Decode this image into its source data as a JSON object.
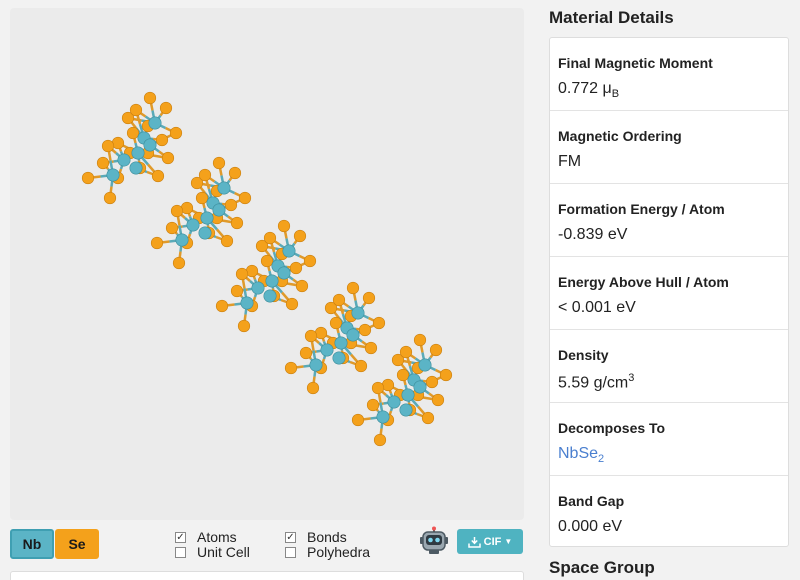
{
  "viewer": {
    "element_buttons": [
      {
        "label": "Nb",
        "color": "#5bb4c6"
      },
      {
        "label": "Se",
        "color": "#f4a11b"
      }
    ],
    "options": {
      "atoms": {
        "label": "Atoms",
        "checked": true
      },
      "unit_cell": {
        "label": "Unit Cell",
        "checked": false
      },
      "bonds": {
        "label": "Bonds",
        "checked": true
      },
      "polyhedra": {
        "label": "Polyhedra",
        "checked": false
      }
    },
    "download": {
      "label": "CIF",
      "icon": "download-icon"
    },
    "assistant_icon": "robot-icon"
  },
  "details": {
    "title": "Material Details",
    "rows": [
      {
        "label": "Final Magnetic Moment",
        "value": "0.772 μ",
        "sub": "B"
      },
      {
        "label": "Magnetic Ordering",
        "value": "FM"
      },
      {
        "label": "Formation Energy / Atom",
        "value": "-0.839 eV"
      },
      {
        "label": "Energy Above Hull / Atom",
        "value": "< 0.001 eV"
      },
      {
        "label": "Density",
        "value": "5.59 g/cm",
        "sup": "3"
      },
      {
        "label": "Decomposes To",
        "value": "NbSe",
        "sub": "2"
      },
      {
        "label": "Band Gap",
        "value": "0.000 eV"
      }
    ]
  },
  "space_group_title": "Space Group"
}
